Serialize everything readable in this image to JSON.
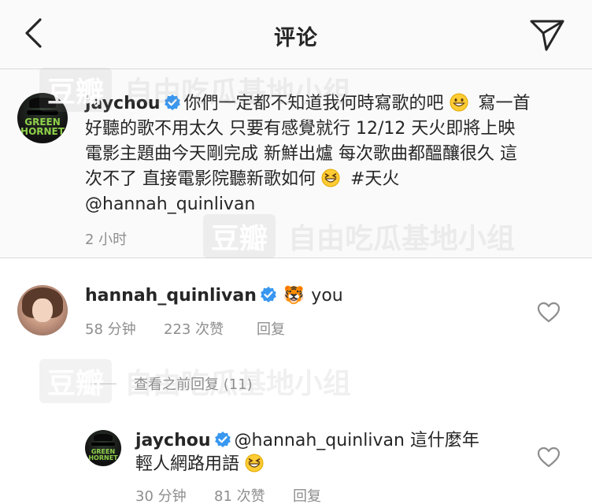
{
  "header": {
    "title": "评论",
    "back_icon": "chevron-left-icon",
    "send_icon": "paper-plane-icon"
  },
  "caption": {
    "username": "jaychou",
    "lines": [
      "你們一定都不知道我何時寫歌的吧",
      "寫一首",
      "好聽的歌不用太久 只要有感覺就行 12/12 天火即將上映",
      "電影主題曲今天剛完成 新鮮出爐 每次歌曲都醞釀很久 這",
      "次不了 直接電影院聽新歌如何",
      "#天火",
      "@hannah_quinlivan"
    ],
    "time": "2 小时"
  },
  "comment": {
    "username": "hannah_quinlivan",
    "emoji": "🐯",
    "text": "you",
    "time": "58 分钟",
    "likes": "223 次赞",
    "reply_label": "回复"
  },
  "view_replies": {
    "label": "查看之前回复 (11)"
  },
  "reply": {
    "username": "jaychou",
    "line1": "@hannah_quinlivan 這什麼年",
    "line2": "輕人網路用語",
    "time": "30 分钟",
    "likes": "81 次赞",
    "reply_label": "回复"
  },
  "watermarks": {
    "badge": "豆瓣",
    "text": "自由吃瓜基地小组"
  },
  "colors": {
    "text": "#262626",
    "muted": "#8e8e8e",
    "verified": "#3897f0",
    "header_bg": "#fafafa",
    "divider": "#dbdbdb"
  }
}
